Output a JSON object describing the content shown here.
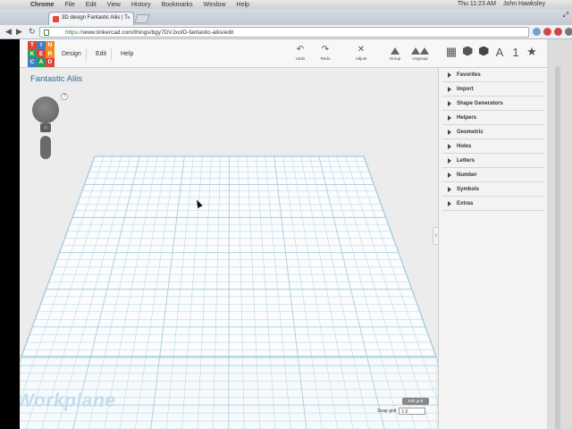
{
  "menubar": {
    "items": [
      "Chrome",
      "File",
      "Edit",
      "View",
      "History",
      "Bookmarks",
      "Window",
      "Help"
    ],
    "clock": "Thu 11:23 AM",
    "user": "John Hawksley"
  },
  "browser": {
    "tab_title": "3D design Fantastic Aliis | T",
    "url_protocol": "https://",
    "url_rest": "www.tinkercad.com/things/bgy7DVJxoID-fantastic-aliis/edit"
  },
  "app": {
    "logo_letters": [
      "TIN",
      "KER",
      "CAD"
    ],
    "menus": [
      "Design",
      "Edit",
      "Help"
    ],
    "tools": [
      {
        "icon": "undo-icon",
        "label": "Undo"
      },
      {
        "icon": "redo-icon",
        "label": "Redo"
      },
      {
        "icon": "adjust-icon",
        "label": "Adjust"
      },
      {
        "icon": "group-icon",
        "label": "Group"
      },
      {
        "icon": "ungroup-icon",
        "label": "Ungroup"
      }
    ],
    "header_icons": [
      "grid-view-icon",
      "hexagon-shape-icon",
      "cube-shape-icon",
      "letter-a-icon",
      "number-one-icon",
      "star-icon"
    ],
    "design_title": "Fantastic Aliis",
    "workplane_label": "Workplane",
    "snap_grid_label": "Snap grid",
    "snap_grid_value": "1.0",
    "edit_grid_label": "Edit grid",
    "help_mark": "?",
    "home_mark": "⌂"
  },
  "library": {
    "categories": [
      "Favorites",
      "Import",
      "Shape Generators",
      "Helpers",
      "Geometric",
      "Holes",
      "Letters",
      "Number",
      "Symbols",
      "Extras"
    ]
  },
  "colors": {
    "title_blue": "#2c6aa0",
    "grid_line": "#a9cde0",
    "workplane_label": "#c3ddea"
  }
}
